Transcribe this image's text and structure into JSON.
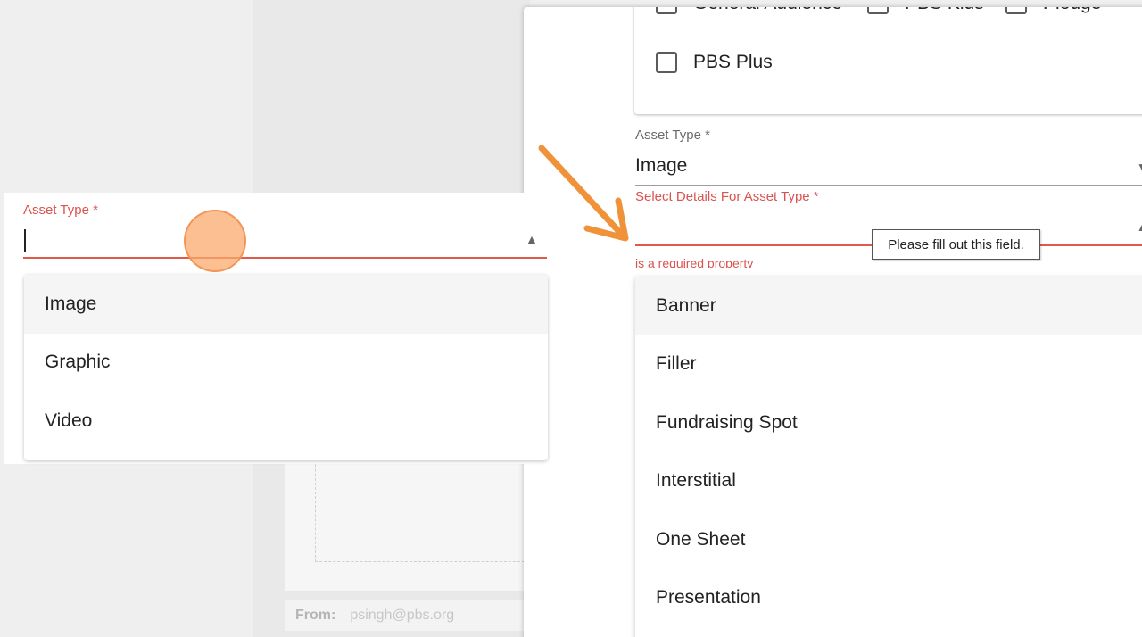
{
  "background": {
    "from_label": "From:",
    "from_value": "psingh@pbs.org"
  },
  "audience": {
    "options": [
      "General Audience",
      "PBS Kids",
      "Pledge",
      "PBS Plus"
    ]
  },
  "asset_type": {
    "label": "Asset Type *",
    "value": "Image"
  },
  "details": {
    "label": "Select Details For Asset Type *",
    "error": "is a required property",
    "tooltip": "Please fill out this field.",
    "options": [
      "Banner",
      "Filler",
      "Fundraising Spot",
      "Interstitial",
      "One Sheet",
      "Presentation"
    ]
  },
  "zoom": {
    "label": "Asset Type *",
    "options": [
      "Image",
      "Graphic",
      "Video"
    ]
  },
  "colors": {
    "error": "#d9534f",
    "highlight": "#f5f5f5",
    "annotation": "#f0923a"
  }
}
